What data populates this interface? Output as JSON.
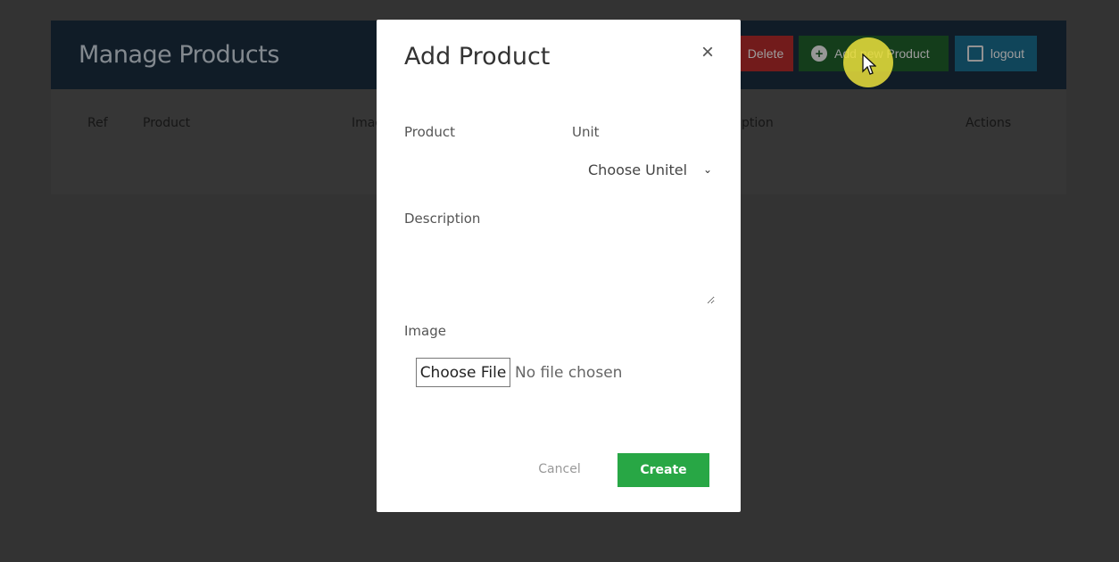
{
  "page": {
    "title": "Manage Products",
    "buttons": {
      "delete_label": "Delete",
      "add_label": "Add new Product",
      "logout_label": "logout"
    },
    "table": {
      "columns": [
        "Ref",
        "Product",
        "Image",
        "Description",
        "Actions"
      ]
    }
  },
  "modal": {
    "title": "Add Product",
    "close_label": "×",
    "fields": {
      "product_label": "Product",
      "unit_label": "Unit",
      "unit_selected": "Choose Unitel",
      "description_label": "Description",
      "image_label": "Image",
      "file_button_label": "Choose File",
      "file_status": "No file chosen"
    },
    "actions": {
      "cancel_label": "Cancel",
      "create_label": "Create"
    }
  },
  "colors": {
    "create": "#28a745",
    "delete": "#b02a2a",
    "add": "#1f5f2a",
    "logout": "#1a6a8a",
    "header": "#1a2b3c"
  }
}
